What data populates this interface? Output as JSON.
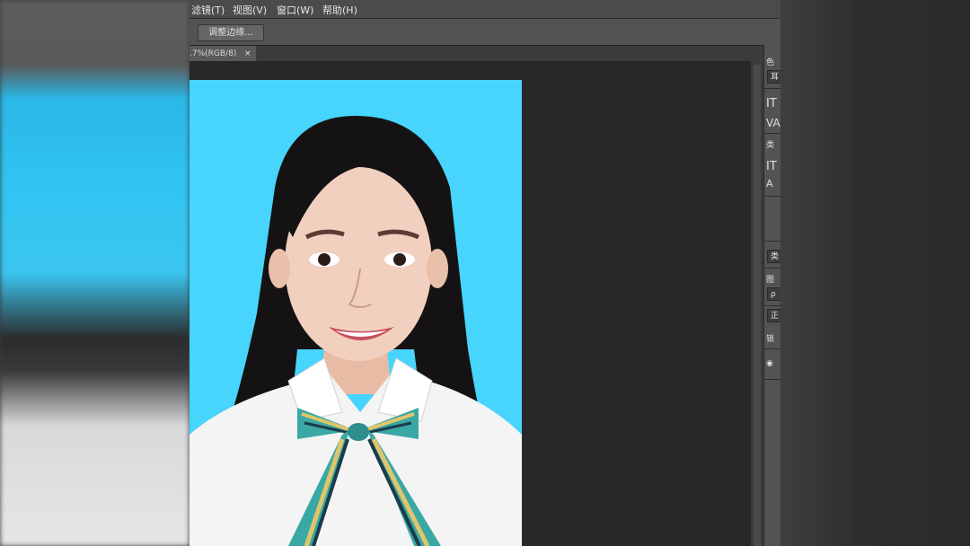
{
  "menu": {
    "items": [
      {
        "label": "滤镜(T)"
      },
      {
        "label": "视图(V)"
      },
      {
        "label": "窗口(W)"
      },
      {
        "label": "帮助(H)"
      }
    ]
  },
  "options_bar": {
    "refine_edge_label": "调整边缘..."
  },
  "document_tab": {
    "title": ".7%(RGB/8)",
    "close_glyph": "×"
  },
  "right_panel": {
    "glyphs": [
      "色",
      "耳",
      "IT",
      "VA",
      "类",
      "IT",
      "A",
      "类",
      "图",
      "ρ",
      "正",
      "锁",
      "◉"
    ]
  },
  "colors": {
    "photo_background": "#47d4fd",
    "menubar": "#4b4b4b",
    "workspace": "#282828"
  }
}
